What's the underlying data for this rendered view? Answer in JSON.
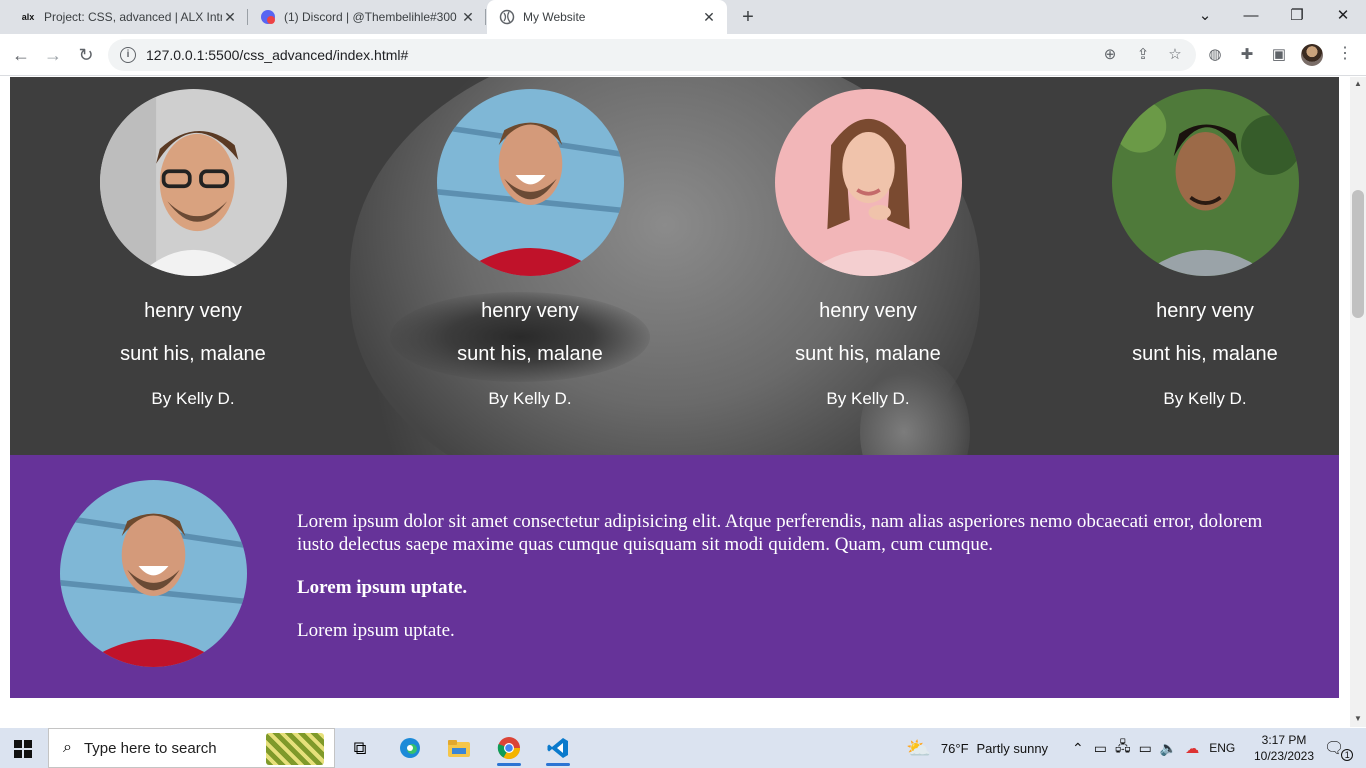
{
  "browser": {
    "tabs": [
      {
        "title": "Project: CSS, advanced | ALX Intr",
        "favicon": "alx",
        "active": false
      },
      {
        "title": "(1) Discord | @Thembelihle#300",
        "favicon": "discord",
        "active": false
      },
      {
        "title": "My Website",
        "favicon": "globe",
        "active": true
      }
    ],
    "url": "127.0.0.1:5500/css_advanced/index.html#"
  },
  "page": {
    "team": [
      {
        "name": "henry veny",
        "role": "sunt his, malane",
        "byline": "By Kelly D.",
        "photo": "man-glasses"
      },
      {
        "name": "henry veny",
        "role": "sunt his, malane",
        "byline": "By Kelly D.",
        "photo": "man-laughing-red-sweater"
      },
      {
        "name": "henry veny",
        "role": "sunt his, malane",
        "byline": "By Kelly D.",
        "photo": "woman-pink-background"
      },
      {
        "name": "henry veny",
        "role": "sunt his, malane",
        "byline": "By Kelly D.",
        "photo": "man-green-background"
      }
    ],
    "feature": {
      "paragraph": "Lorem ipsum dolor sit amet consectetur adipisicing elit. Atque perferendis, nam alias asperiores nemo obcaecati error, dolorem iusto delectus saepe maxime quas cumque quisquam sit modi quidem. Quam, cum cumque.",
      "bold_line": "Lorem ipsum uptate.",
      "plain_line": "Lorem ipsum uptate.",
      "photo": "man-laughing-red-sweater"
    },
    "colors": {
      "feature_bg": "#663399",
      "text": "#ffffff"
    }
  },
  "taskbar": {
    "search_placeholder": "Type here to search",
    "weather": {
      "temp": "76°F",
      "condition": "Partly sunny"
    },
    "language": "ENG",
    "time": "3:17 PM",
    "date": "10/23/2023",
    "notification_count": "1"
  }
}
